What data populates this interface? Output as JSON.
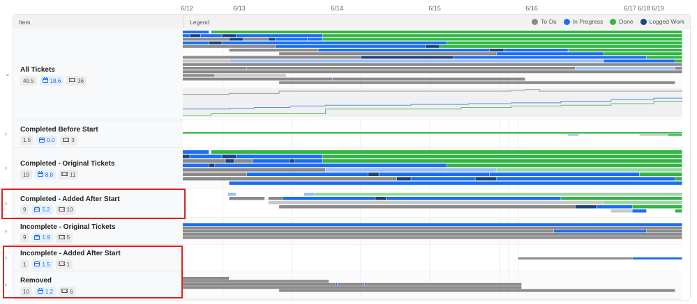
{
  "timeline": {
    "ticks": [
      "6/12",
      "6/13",
      "6/14",
      "6/15",
      "6/16",
      "6/17",
      "6/18",
      "6/19"
    ]
  },
  "header": {
    "item": "Item",
    "legend": "Legend"
  },
  "legend": [
    {
      "label": "To-Do",
      "color": "#8a8a8a"
    },
    {
      "label": "In Progress",
      "color": "#1a6ef5"
    },
    {
      "label": "Done",
      "color": "#33b544"
    },
    {
      "label": "Logged Work",
      "color": "#1b4480"
    }
  ],
  "status_colors": {
    "t": "#8a8a8a",
    "p": "#1a6ef5",
    "d": "#33b544",
    "l": "#1b4480",
    "lt": "#c8c8c8",
    "lp": "#9dbff7",
    "ld": "#9ad8a3"
  },
  "groups": [
    {
      "title": "All Tickets",
      "points": "49.5",
      "days": "18.6",
      "tickets": "36",
      "expanded": true,
      "lanes": [
        [
          [
            0,
            0.37,
            "p"
          ],
          [
            0.4,
            7,
            "d"
          ]
        ],
        [
          [
            0,
            0.1,
            "p"
          ],
          [
            0.1,
            0.25,
            "l"
          ],
          [
            0.25,
            0.55,
            "p"
          ],
          [
            0.55,
            0.75,
            "l"
          ],
          [
            0.75,
            1.96,
            "p"
          ],
          [
            1.96,
            7,
            "d"
          ]
        ],
        [
          [
            0,
            0.65,
            "t"
          ],
          [
            0.65,
            0.85,
            "l"
          ],
          [
            0.85,
            1.2,
            "t"
          ],
          [
            1.2,
            1.3,
            "l"
          ],
          [
            1.3,
            1.75,
            "p"
          ],
          [
            1.75,
            1.96,
            "p"
          ],
          [
            1.96,
            7,
            "d"
          ]
        ],
        [
          [
            0,
            0.37,
            "p"
          ],
          [
            0.37,
            0.55,
            "l"
          ],
          [
            0.55,
            3.7,
            "p"
          ],
          [
            3.7,
            7,
            "d"
          ]
        ],
        [
          [
            0,
            1.3,
            "t"
          ],
          [
            1.3,
            3.4,
            "p"
          ],
          [
            3.4,
            3.6,
            "l"
          ],
          [
            3.6,
            7,
            "d"
          ]
        ],
        [
          [
            0.65,
            1.9,
            "t"
          ],
          [
            1.9,
            4.3,
            "p"
          ],
          [
            4.3,
            4.5,
            "l"
          ],
          [
            4.5,
            5.4,
            "p"
          ],
          [
            5.4,
            7,
            "d"
          ]
        ],
        [
          [
            1.35,
            4.4,
            "t"
          ],
          [
            4.4,
            5.9,
            "p"
          ],
          [
            5.9,
            7,
            "d"
          ]
        ],
        [
          [
            0,
            2.5,
            "t"
          ],
          [
            2.5,
            3.8,
            "l"
          ],
          [
            3.8,
            6.5,
            "p"
          ],
          [
            6.5,
            7,
            "d"
          ]
        ],
        [
          [
            0,
            0.65,
            "lt"
          ],
          [
            0.65,
            5.9,
            "lp"
          ],
          [
            5.9,
            6.9,
            "p"
          ],
          [
            6.9,
            7,
            "d"
          ]
        ],
        [
          [
            0,
            7,
            "t"
          ]
        ],
        [
          [
            0,
            0.9,
            "t"
          ],
          [
            0.9,
            5.5,
            "t"
          ],
          [
            5.5,
            6.9,
            "lp"
          ],
          [
            6.9,
            7,
            "t"
          ]
        ],
        [
          [
            0,
            7,
            "t"
          ]
        ],
        [
          [
            0,
            0.45,
            "t"
          ],
          [
            0.45,
            1.45,
            "lt"
          ]
        ],
        [
          [
            0,
            2.1,
            "t"
          ],
          [
            2.1,
            2.12,
            "p"
          ],
          [
            2.12,
            4.8,
            "t"
          ]
        ],
        [
          [
            1.35,
            6.9,
            "t"
          ]
        ]
      ]
    },
    {
      "title": "Completed Before Start",
      "points": "1.5",
      "days": "0.0",
      "tickets": "3",
      "lanes": [
        [
          [
            0,
            7,
            "d"
          ]
        ],
        [
          [
            5.4,
            5.55,
            "lp"
          ],
          [
            6.4,
            6.8,
            "lt"
          ],
          [
            6.8,
            7,
            "d"
          ]
        ]
      ]
    },
    {
      "title": "Completed - Original Tickets",
      "points": "19",
      "days": "8.8",
      "tickets": "11",
      "lanes": [
        [
          [
            0,
            0.37,
            "p"
          ],
          [
            0.4,
            7,
            "d"
          ]
        ],
        [
          [
            0,
            0.1,
            "l"
          ],
          [
            0.1,
            0.55,
            "p"
          ],
          [
            0.55,
            0.75,
            "l"
          ],
          [
            0.75,
            1.96,
            "p"
          ],
          [
            1.96,
            7,
            "d"
          ]
        ],
        [
          [
            0,
            0.6,
            "t"
          ],
          [
            0.6,
            0.72,
            "l"
          ],
          [
            0.72,
            0.98,
            "t"
          ],
          [
            0.98,
            1.5,
            "p"
          ],
          [
            1.5,
            1.56,
            "l"
          ],
          [
            1.56,
            1.96,
            "p"
          ],
          [
            1.96,
            7,
            "d"
          ]
        ],
        [
          [
            0,
            0.37,
            "p"
          ],
          [
            0.37,
            0.45,
            "l"
          ],
          [
            0.45,
            3.7,
            "p"
          ],
          [
            3.7,
            7,
            "d"
          ]
        ],
        [
          [
            0,
            2.0,
            "t"
          ],
          [
            2.0,
            4.4,
            "lp"
          ],
          [
            4.4,
            7,
            "ld"
          ]
        ],
        [
          [
            0,
            0.9,
            "t"
          ],
          [
            0.9,
            2.6,
            "p"
          ],
          [
            2.6,
            2.75,
            "l"
          ],
          [
            2.75,
            4.3,
            "p"
          ],
          [
            4.3,
            6.4,
            "p"
          ],
          [
            6.4,
            7,
            "d"
          ]
        ],
        [
          [
            0,
            3.0,
            "t"
          ],
          [
            3.0,
            3.2,
            "l"
          ],
          [
            3.2,
            4.1,
            "p"
          ],
          [
            4.1,
            4.4,
            "l"
          ],
          [
            4.4,
            6.9,
            "p"
          ],
          [
            6.9,
            7,
            "d"
          ]
        ],
        [
          [
            0.65,
            7,
            "p"
          ]
        ]
      ]
    },
    {
      "title": "Completed - Added After Start",
      "points": "9",
      "days": "5.2",
      "tickets": "10",
      "lanes": [
        [
          [
            0.63,
            0.75,
            "lp"
          ],
          [
            1.7,
            1.85,
            "lp"
          ],
          [
            1.85,
            7,
            "ld"
          ]
        ],
        [
          [
            0.65,
            1.15,
            "t"
          ],
          [
            1.2,
            1.4,
            "t"
          ],
          [
            1.4,
            2.7,
            "p"
          ],
          [
            2.7,
            2.85,
            "l"
          ],
          [
            2.85,
            5.3,
            "p"
          ],
          [
            5.3,
            7,
            "d"
          ]
        ],
        [
          [
            1.2,
            5.9,
            "lt"
          ],
          [
            5.9,
            7,
            "ld"
          ]
        ],
        [
          [
            1.35,
            5.5,
            "t"
          ],
          [
            5.5,
            5.8,
            "l"
          ],
          [
            5.8,
            6.3,
            "p"
          ],
          [
            6.3,
            7,
            "d"
          ]
        ],
        [
          [
            6.0,
            6.3,
            "lt"
          ],
          [
            6.3,
            6.5,
            "p"
          ],
          [
            6.9,
            7,
            "d"
          ]
        ]
      ]
    },
    {
      "title": "Incomplete - Original Tickets",
      "points": "9",
      "days": "1.9",
      "tickets": "5",
      "lanes": [
        [
          [
            0,
            7,
            "p"
          ]
        ],
        [
          [
            0,
            7,
            "t"
          ]
        ],
        [
          [
            0,
            5.2,
            "t"
          ],
          [
            5.2,
            6.5,
            "p"
          ],
          [
            6.5,
            7,
            "t"
          ]
        ],
        [
          [
            0,
            7,
            "t"
          ]
        ],
        [
          [
            0,
            7,
            "t"
          ]
        ]
      ]
    },
    {
      "title": "Incomplete - Added After Start",
      "points": "1",
      "days": "1.5",
      "tickets": "1",
      "lanes": [
        [
          [
            4.7,
            6.3,
            "t"
          ],
          [
            6.3,
            7,
            "p"
          ]
        ]
      ]
    },
    {
      "title": "Removed",
      "points": "10",
      "days": "1.2",
      "tickets": "6",
      "lanes": [
        [
          [
            0,
            0.65,
            "t"
          ]
        ],
        [
          [
            0,
            2.05,
            "t"
          ]
        ],
        [
          [
            0,
            2.15,
            "t"
          ],
          [
            2.15,
            2.17,
            "p"
          ],
          [
            2.17,
            2.55,
            "t"
          ],
          [
            2.55,
            2.57,
            "p"
          ],
          [
            2.57,
            4.75,
            "t"
          ]
        ],
        [
          [
            0,
            4.75,
            "t"
          ]
        ],
        [
          [
            1.35,
            6.9,
            "t"
          ]
        ]
      ]
    }
  ],
  "burnup": {
    "scope": [
      [
        0,
        29
      ],
      [
        0.65,
        30
      ],
      [
        1.35,
        33
      ],
      [
        3.0,
        33
      ],
      [
        4.6,
        34
      ],
      [
        4.8,
        35
      ],
      [
        5.0,
        33
      ],
      [
        7,
        33
      ]
    ],
    "in_progress": [
      [
        0,
        10
      ],
      [
        0.65,
        11
      ],
      [
        1.0,
        12
      ],
      [
        1.5,
        14
      ],
      [
        2.0,
        15
      ],
      [
        3.2,
        16
      ],
      [
        4.0,
        17
      ],
      [
        4.6,
        18
      ],
      [
        5.3,
        20
      ],
      [
        6.0,
        22
      ],
      [
        6.6,
        24
      ],
      [
        7,
        25
      ]
    ],
    "done": [
      [
        0,
        2
      ],
      [
        0.4,
        4
      ],
      [
        2.0,
        10
      ],
      [
        3.9,
        12
      ],
      [
        4.6,
        14
      ],
      [
        5.3,
        15
      ],
      [
        6.0,
        17
      ],
      [
        6.6,
        20
      ],
      [
        7,
        23
      ]
    ]
  }
}
